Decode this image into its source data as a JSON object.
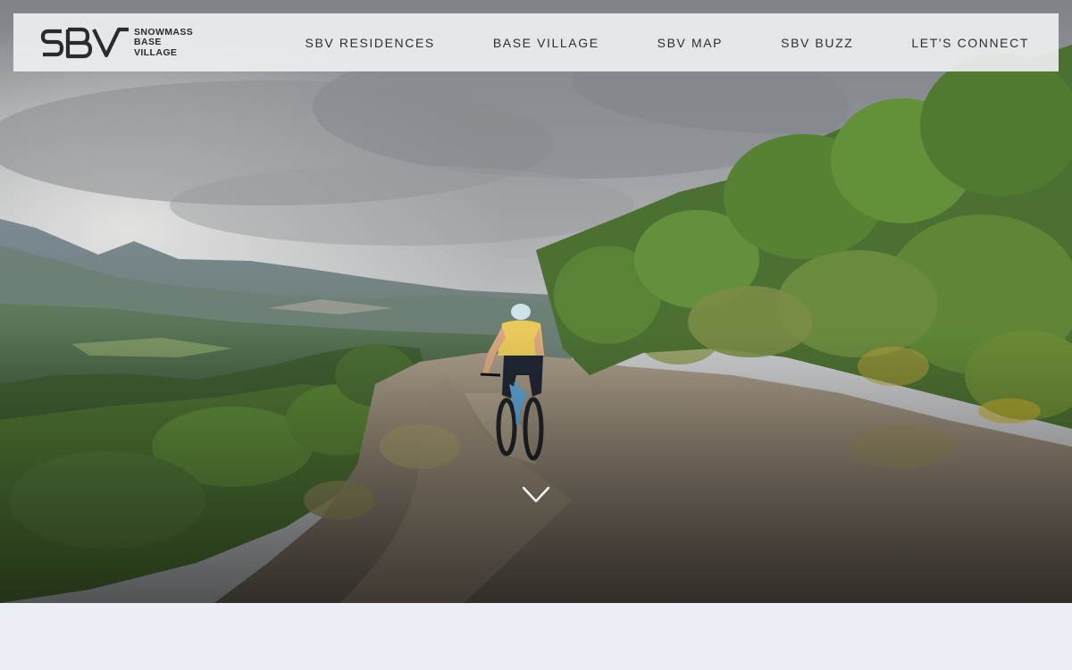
{
  "brand": {
    "monogram": "SBV",
    "name_lines": [
      "SNOWMASS",
      "BASE",
      "VILLAGE"
    ]
  },
  "nav": {
    "items": [
      {
        "label": "SBV RESIDENCES"
      },
      {
        "label": "BASE VILLAGE"
      },
      {
        "label": "SBV MAP"
      },
      {
        "label": "SBV BUZZ"
      },
      {
        "label": "LET'S CONNECT"
      }
    ]
  },
  "hero": {
    "media": "video-background",
    "scroll_cue_icon": "chevron-down-icon"
  },
  "colors": {
    "header_bg": "#f0f1f3",
    "nav_text": "#2d2e30",
    "page_bg": "#eceef6",
    "rider_jersey": "#e9c95a",
    "bike": "#5aa3d6"
  }
}
